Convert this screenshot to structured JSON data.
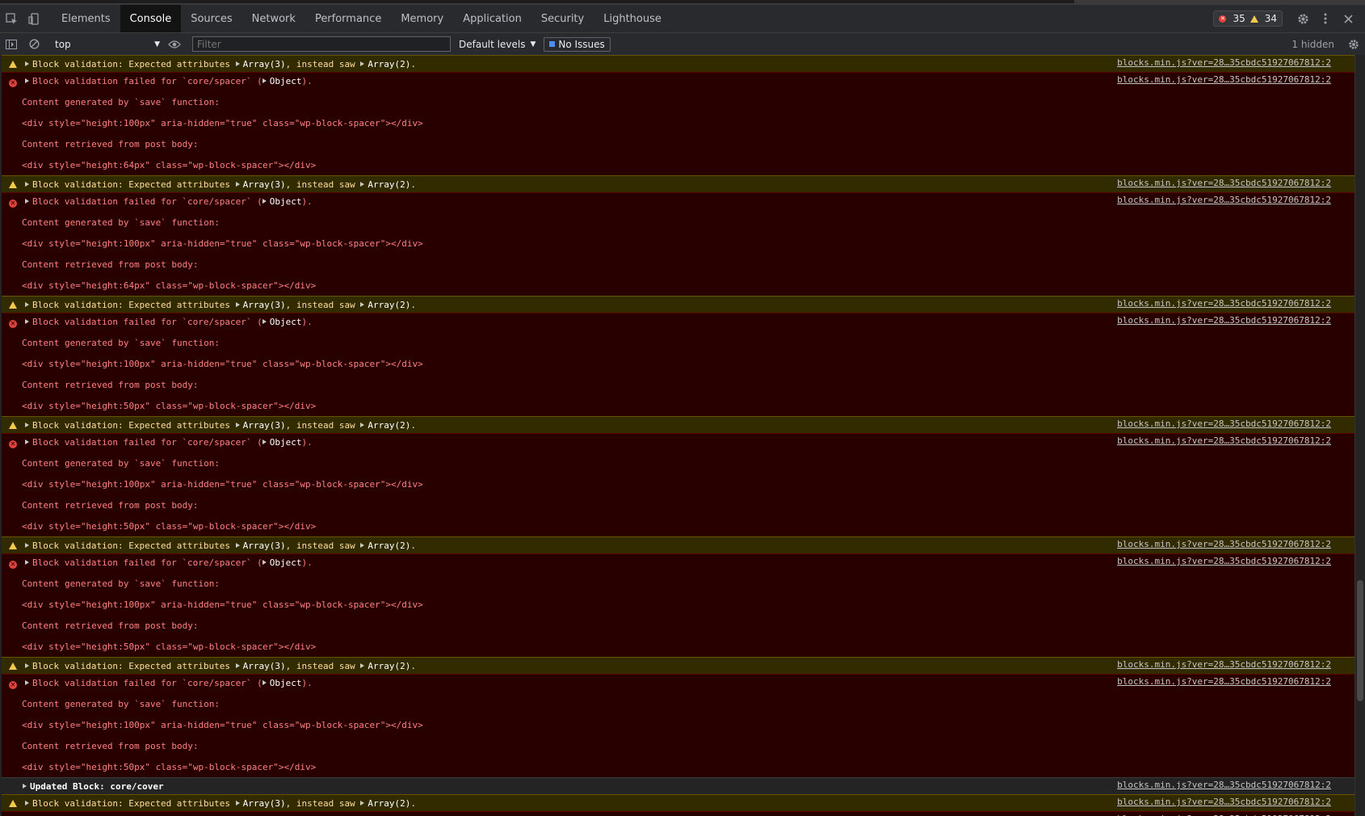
{
  "tabs": [
    "Elements",
    "Console",
    "Sources",
    "Network",
    "Performance",
    "Memory",
    "Application",
    "Security",
    "Lighthouse"
  ],
  "active_tab": "Console",
  "counts": {
    "errors": "35",
    "warnings": "34"
  },
  "toolbar": {
    "context": "top",
    "filter_placeholder": "Filter",
    "levels": "Default levels",
    "issues": "No Issues",
    "hidden": "1 hidden"
  },
  "source_link": "blocks.min.js?ver=28…35cbdc51927067812:2",
  "messages": [
    {
      "type": "warn"
    },
    {
      "type": "error",
      "save": "<div style=\"height:100px\" aria-hidden=\"true\" class=\"wp-block-spacer\"></div>",
      "post": "<div style=\"height:64px\" class=\"wp-block-spacer\"></div>"
    },
    {
      "type": "warn"
    },
    {
      "type": "error",
      "save": "<div style=\"height:100px\" aria-hidden=\"true\" class=\"wp-block-spacer\"></div>",
      "post": "<div style=\"height:64px\" class=\"wp-block-spacer\"></div>"
    },
    {
      "type": "warn"
    },
    {
      "type": "error",
      "save": "<div style=\"height:100px\" aria-hidden=\"true\" class=\"wp-block-spacer\"></div>",
      "post": "<div style=\"height:50px\" class=\"wp-block-spacer\"></div>"
    },
    {
      "type": "warn"
    },
    {
      "type": "error",
      "save": "<div style=\"height:100px\" aria-hidden=\"true\" class=\"wp-block-spacer\"></div>",
      "post": "<div style=\"height:50px\" class=\"wp-block-spacer\"></div>"
    },
    {
      "type": "warn"
    },
    {
      "type": "error",
      "save": "<div style=\"height:100px\" aria-hidden=\"true\" class=\"wp-block-spacer\"></div>",
      "post": "<div style=\"height:50px\" class=\"wp-block-spacer\"></div>"
    },
    {
      "type": "warn"
    },
    {
      "type": "error",
      "save": "<div style=\"height:100px\" aria-hidden=\"true\" class=\"wp-block-spacer\"></div>",
      "post": "<div style=\"height:50px\" class=\"wp-block-spacer\"></div>"
    },
    {
      "type": "log",
      "text": "Updated Block: core/cover"
    },
    {
      "type": "warn"
    },
    {
      "type": "error",
      "save": "",
      "post": ""
    }
  ],
  "text": {
    "warn_prefix": "Block validation: Expected attributes",
    "warn_array3": "Array(3)",
    "warn_mid": ", instead saw",
    "warn_array2": "Array(2)",
    "warn_end": ".",
    "error_prefix": "Block validation failed for `core/spacer` (",
    "error_object": "Object",
    "error_end": ").",
    "save_label": "Content generated by `save` function:",
    "post_label": "Content retrieved from post body:"
  }
}
